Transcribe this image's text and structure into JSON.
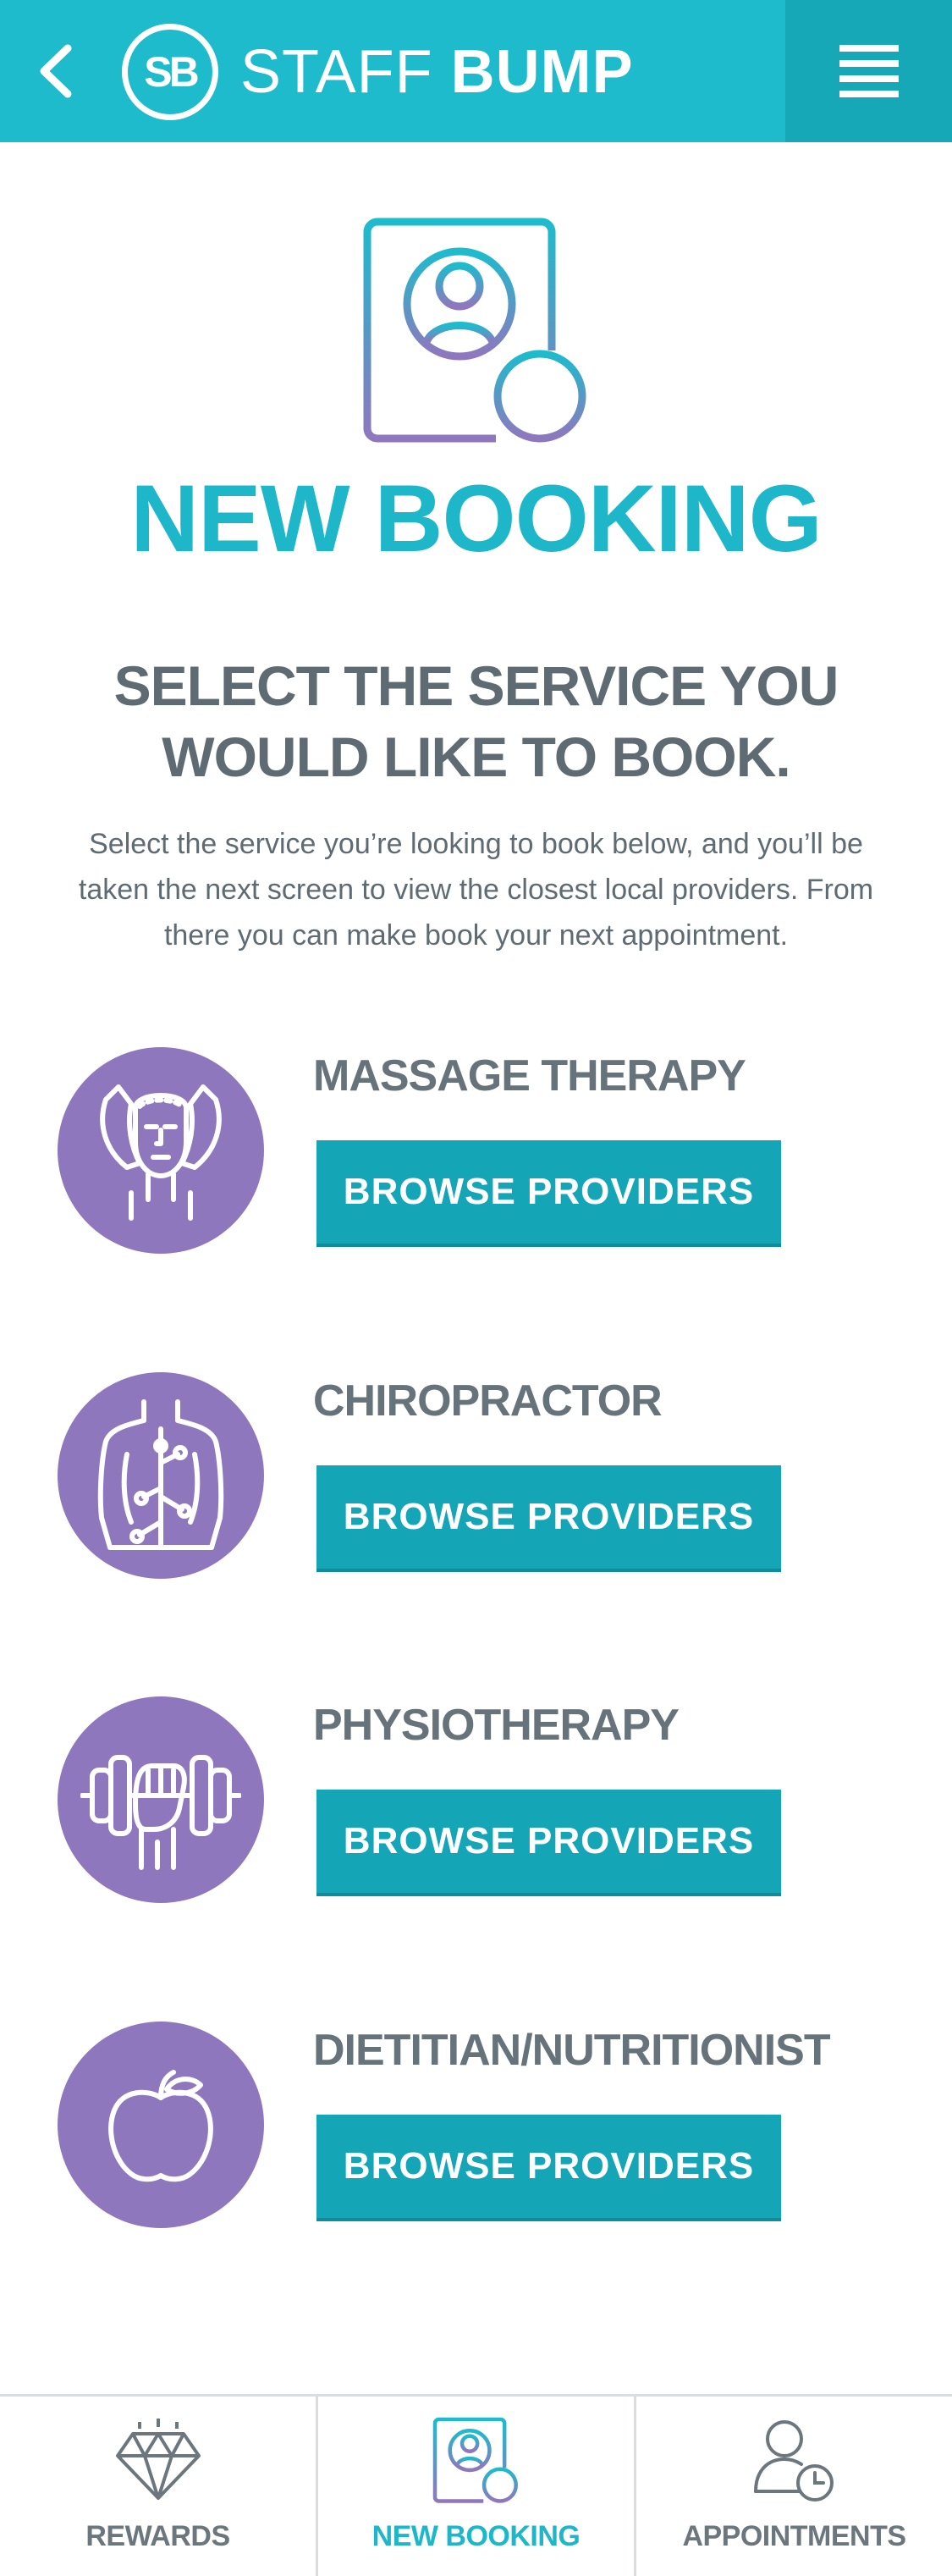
{
  "header": {
    "logo_initials": "SB",
    "logo_text_light": "STAFF",
    "logo_text_bold": "BUMP",
    "back_icon": "chevron-left-icon",
    "menu_icon": "hamburger-menu-icon"
  },
  "colors": {
    "brand_teal": "#1ebbcc",
    "button_teal": "#14a5b7",
    "service_purple": "#8f77be",
    "text_gray": "#5f6b73"
  },
  "page": {
    "icon": "new-booking-icon",
    "title": "NEW BOOKING",
    "subtitle": "SELECT THE SERVICE YOU WOULD LIKE TO BOOK.",
    "description": "Select the service you’re looking to book below, and you’ll be taken the next screen to view the closest local providers. From there you can make book your next appointment."
  },
  "services": [
    {
      "name": "MASSAGE THERAPY",
      "button_label": "BROWSE PROVIDERS",
      "icon": "massage-face-icon"
    },
    {
      "name": "CHIROPRACTOR",
      "button_label": "BROWSE PROVIDERS",
      "icon": "spine-back-icon"
    },
    {
      "name": "PHYSIOTHERAPY",
      "button_label": "BROWSE PROVIDERS",
      "icon": "dumbbell-hand-icon"
    },
    {
      "name": "DIETITIAN/NUTRITIONIST",
      "button_label": "BROWSE PROVIDERS",
      "icon": "apple-icon"
    }
  ],
  "tabbar": {
    "tabs": [
      {
        "label": "REWARDS",
        "icon": "diamond-icon",
        "active": false
      },
      {
        "label": "NEW BOOKING",
        "icon": "new-booking-icon",
        "active": true
      },
      {
        "label": "APPOINTMENTS",
        "icon": "user-clock-icon",
        "active": false
      }
    ]
  }
}
